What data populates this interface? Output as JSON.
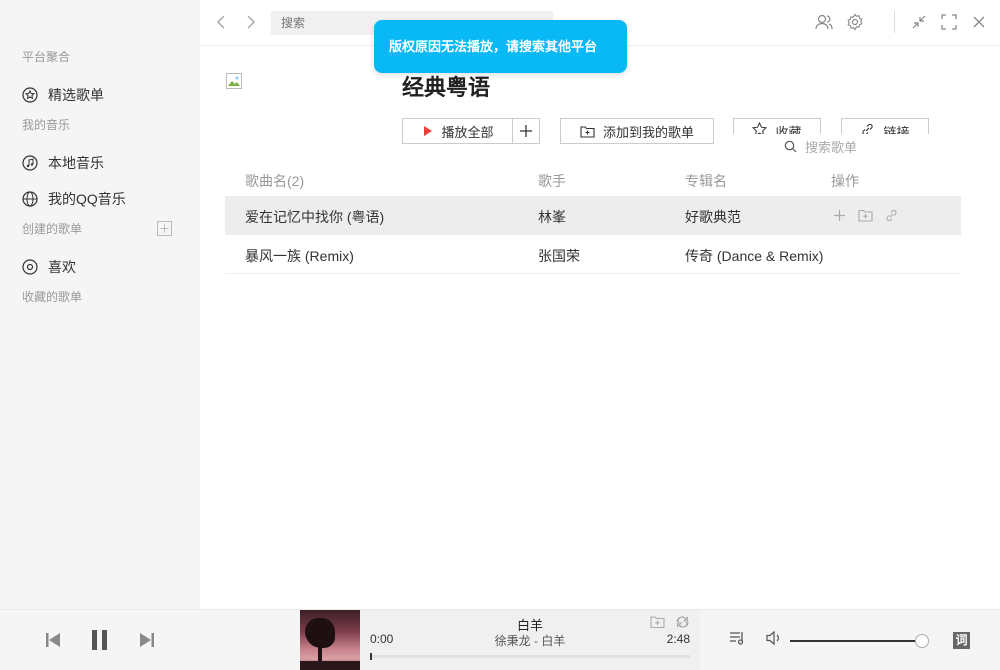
{
  "sidebar": {
    "sections": {
      "platform": "平台聚合",
      "my_music": "我的音乐",
      "created": "创建的歌单",
      "collected": "收藏的歌单"
    },
    "items": {
      "featured": {
        "label": "精选歌单",
        "icon": "star-icon"
      },
      "local": {
        "label": "本地音乐",
        "icon": "music-note-icon"
      },
      "qq": {
        "label": "我的QQ音乐",
        "icon": "globe-icon"
      },
      "favorite": {
        "label": "喜欢",
        "icon": "disc-icon"
      }
    }
  },
  "topbar": {
    "search_placeholder": "搜索"
  },
  "toast": {
    "message": "版权原因无法播放，请搜索其他平台"
  },
  "playlist": {
    "title": "经典粤语",
    "buttons": {
      "play_all": "播放全部",
      "add_to_my": "添加到我的歌单",
      "collect": "收藏",
      "link": "链接"
    },
    "search_placeholder": "搜索歌单",
    "columns": {
      "song": "歌曲名(2)",
      "artist": "歌手",
      "album": "专辑名",
      "ops": "操作"
    },
    "songs": [
      {
        "title": "爱在记忆中找你 (粤语)",
        "artist": "林峯",
        "album": "好歌典范"
      },
      {
        "title": "暴风一族 (Remix)",
        "artist": "张国荣",
        "album": "传奇 (Dance & Remix)"
      }
    ]
  },
  "player": {
    "track_title": "白羊",
    "track_artist": "徐秉龙 - 白羊",
    "time_current": "0:00",
    "time_total": "2:48",
    "progress": 0.0,
    "volume": 0.95,
    "lyric_label": "词"
  },
  "colors": {
    "accent": "#08b9f5",
    "play_red": "#e8413c",
    "sidebar_bg": "#f5f5f5"
  }
}
